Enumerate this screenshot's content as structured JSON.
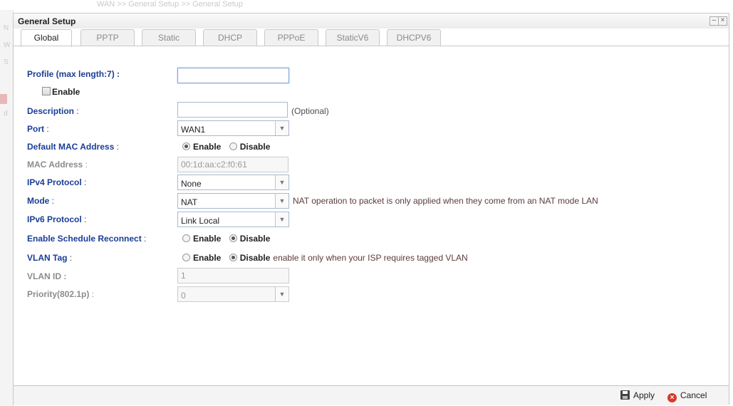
{
  "background": {
    "breadcrumb": "WAN >> General Setup >> General Setup"
  },
  "dialog": {
    "title": "General Setup",
    "minimize_glyph": "–",
    "close_glyph": "×"
  },
  "tabs": [
    {
      "label": "Global",
      "active": true
    },
    {
      "label": "PPTP"
    },
    {
      "label": "Static"
    },
    {
      "label": "DHCP"
    },
    {
      "label": "PPPoE"
    },
    {
      "label": "StaticV6"
    },
    {
      "label": "DHCPV6"
    }
  ],
  "form": {
    "profile": {
      "label": "Profile (max length:7) :",
      "value": ""
    },
    "enable": {
      "label": "Enable",
      "checked": false
    },
    "description": {
      "label": "Description",
      "sep": " :",
      "value": "",
      "note": "(Optional)"
    },
    "port": {
      "label": "Port",
      "sep": " :",
      "value": "WAN1"
    },
    "default_mac": {
      "label": "Default MAC Address",
      "sep": " :",
      "enable": "Enable",
      "disable": "Disable",
      "selected": "Enable"
    },
    "mac_address": {
      "label": "MAC Address",
      "sep": " :",
      "value": "00:1d:aa:c2:f0:61"
    },
    "ipv4_protocol": {
      "label": "IPv4 Protocol",
      "sep": " :",
      "value": "None"
    },
    "mode": {
      "label": "Mode",
      "sep": " :",
      "value": "NAT",
      "note": "NAT operation to packet is only applied when they come from an NAT mode LAN"
    },
    "ipv6_protocol": {
      "label": "IPv6 Protocol",
      "sep": " :",
      "value": "Link Local"
    },
    "schedule_reconnect": {
      "label": "Enable Schedule Reconnect",
      "sep": " :",
      "enable": "Enable",
      "disable": "Disable",
      "selected": "Disable"
    },
    "vlan_tag": {
      "label": "VLAN Tag",
      "sep": " :",
      "enable": "Enable",
      "disable": "Disable",
      "selected": "Disable",
      "note": "enable it only when your ISP requires tagged VLAN"
    },
    "vlan_id": {
      "label": "VLAN ID :",
      "value": "1"
    },
    "priority": {
      "label": "Priority(802.1p)",
      "sep": " :",
      "value": "0"
    }
  },
  "footer": {
    "apply": "Apply",
    "cancel": "Cancel",
    "apply_icon": "save-icon",
    "cancel_icon": "cancel-icon"
  },
  "colors": {
    "label_blue": "#1b3d96",
    "note_brown": "#5b3c3c",
    "cancel_red": "#d63a2a"
  }
}
